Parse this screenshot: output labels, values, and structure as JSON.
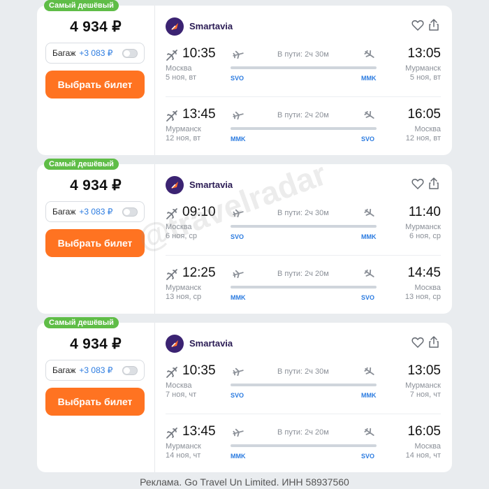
{
  "colors": {
    "badge": "#5fbd47",
    "button": "#ff7321",
    "airport_code": "#2b7be0",
    "airline_logo": "#3b2372"
  },
  "cards": [
    {
      "badge": "Самый дешёвый",
      "price": "4 934 ₽",
      "baggage_label": "Багаж",
      "baggage_price": "+3 083 ₽",
      "buy_label": "Выбрать билет",
      "airline": "Smartavia",
      "segments": [
        {
          "dep_time": "10:35",
          "arr_time": "13:05",
          "duration": "В пути: 2ч 30м",
          "dep_city": "Москва",
          "dep_date": "5 ноя, вт",
          "arr_city": "Мурманск",
          "arr_date": "5 ноя, вт",
          "dep_code": "SVO",
          "arr_code": "MMK"
        },
        {
          "dep_time": "13:45",
          "arr_time": "16:05",
          "duration": "В пути: 2ч 20м",
          "dep_city": "Мурманск",
          "dep_date": "12 ноя, вт",
          "arr_city": "Москва",
          "arr_date": "12 ноя, вт",
          "dep_code": "MMK",
          "arr_code": "SVO"
        }
      ]
    },
    {
      "badge": "Самый дешёвый",
      "price": "4 934 ₽",
      "baggage_label": "Багаж",
      "baggage_price": "+3 083 ₽",
      "buy_label": "Выбрать билет",
      "airline": "Smartavia",
      "segments": [
        {
          "dep_time": "09:10",
          "arr_time": "11:40",
          "duration": "В пути: 2ч 30м",
          "dep_city": "Москва",
          "dep_date": "6 ноя, ср",
          "arr_city": "Мурманск",
          "arr_date": "6 ноя, ср",
          "dep_code": "SVO",
          "arr_code": "MMK"
        },
        {
          "dep_time": "12:25",
          "arr_time": "14:45",
          "duration": "В пути: 2ч 20м",
          "dep_city": "Мурманск",
          "dep_date": "13 ноя, ср",
          "arr_city": "Москва",
          "arr_date": "13 ноя, ср",
          "dep_code": "MMK",
          "arr_code": "SVO"
        }
      ]
    },
    {
      "badge": "Самый дешёвый",
      "price": "4 934 ₽",
      "baggage_label": "Багаж",
      "baggage_price": "+3 083 ₽",
      "buy_label": "Выбрать билет",
      "airline": "Smartavia",
      "segments": [
        {
          "dep_time": "10:35",
          "arr_time": "13:05",
          "duration": "В пути: 2ч 30м",
          "dep_city": "Москва",
          "dep_date": "7 ноя, чт",
          "arr_city": "Мурманск",
          "arr_date": "7 ноя, чт",
          "dep_code": "SVO",
          "arr_code": "MMK"
        },
        {
          "dep_time": "13:45",
          "arr_time": "16:05",
          "duration": "В пути: 2ч 20м",
          "dep_city": "Мурманск",
          "dep_date": "14 ноя, чт",
          "arr_city": "Москва",
          "arr_date": "14 ноя, чт",
          "dep_code": "MMK",
          "arr_code": "SVO"
        }
      ]
    }
  ],
  "watermark": "@travelradar",
  "footer": "Реклама. Go Travel Un Limited. ИНН 58937560"
}
